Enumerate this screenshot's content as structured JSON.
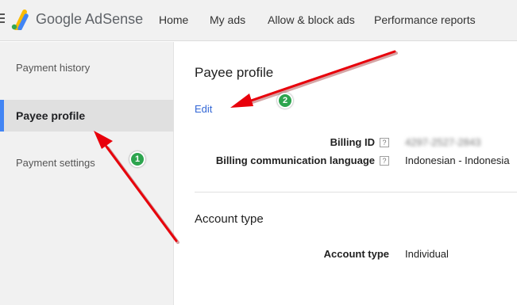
{
  "app": {
    "brand": "Google AdSense"
  },
  "nav": {
    "items": [
      {
        "label": "Home"
      },
      {
        "label": "My ads"
      },
      {
        "label": "Allow & block ads"
      },
      {
        "label": "Performance reports"
      }
    ]
  },
  "sidebar": {
    "items": [
      {
        "label": "Payment history",
        "active": false
      },
      {
        "label": "Payee profile",
        "active": true
      },
      {
        "label": "Payment settings",
        "active": false
      }
    ]
  },
  "main": {
    "title": "Payee profile",
    "edit_label": "Edit",
    "fields": [
      {
        "label": "Billing ID",
        "help": "?",
        "value": "4297-2527-2843"
      },
      {
        "label": "Billing communication language",
        "help": "?",
        "value": "Indonesian - Indonesia"
      }
    ],
    "account_section": {
      "title": "Account type",
      "fields": [
        {
          "label": "Account type",
          "value": "Individual"
        }
      ]
    }
  },
  "annotations": {
    "badges": [
      {
        "number": "1"
      },
      {
        "number": "2"
      }
    ],
    "arrow_color": "#e8000b",
    "badge_color": "#2da44e"
  },
  "colors": {
    "accent": "#4285f4",
    "link": "#3367d6"
  }
}
